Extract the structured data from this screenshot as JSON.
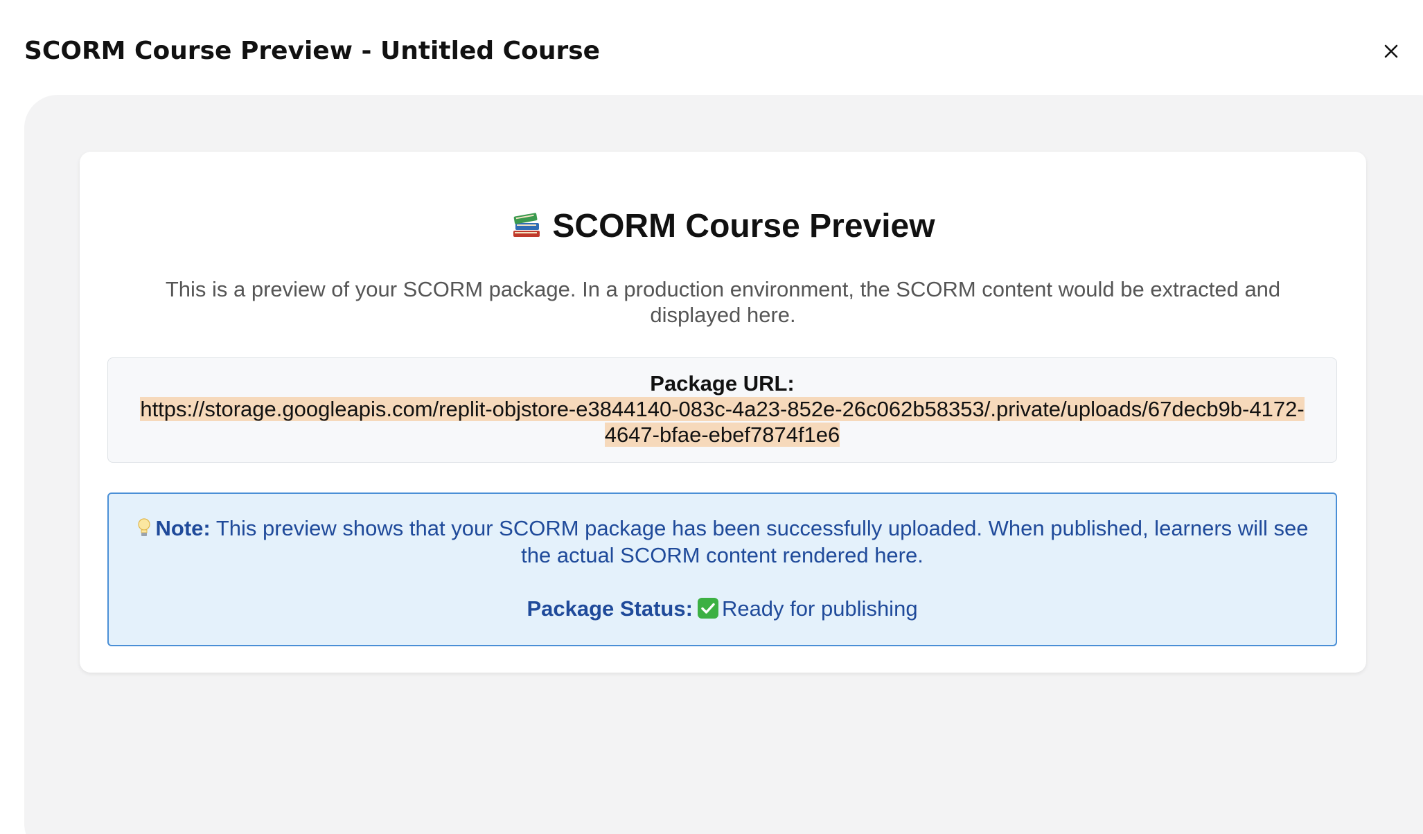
{
  "dialog": {
    "title": "SCORM Course Preview - Untitled Course",
    "close_icon": "close-icon"
  },
  "preview": {
    "heading": "SCORM Course Preview",
    "heading_icon": "books-icon",
    "description": "This is a preview of your SCORM package. In a production environment, the SCORM content would be extracted and displayed here.",
    "package_url_label": "Package URL:",
    "package_url": "https://storage.googleapis.com/replit-objstore-e3844140-083c-4a23-852e-26c062b58353/.private/uploads/67decb9b-4172-4647-bfae-ebef7874f1e6",
    "note_icon": "lightbulb-icon",
    "note_label": "Note:",
    "note_text": "This preview shows that your SCORM package has been successfully uploaded. When published, learners will see the actual SCORM content rendered here.",
    "status_label": "Package Status:",
    "status_icon": "check-icon",
    "status_text": "Ready for publishing"
  },
  "colors": {
    "frame_bg": "#f3f3f4",
    "note_bg": "#e4f1fb",
    "note_border": "#4a8fd6",
    "note_text": "#1f4a9a",
    "url_highlight": "#f6d9bb",
    "status_check": "#3cb043"
  }
}
